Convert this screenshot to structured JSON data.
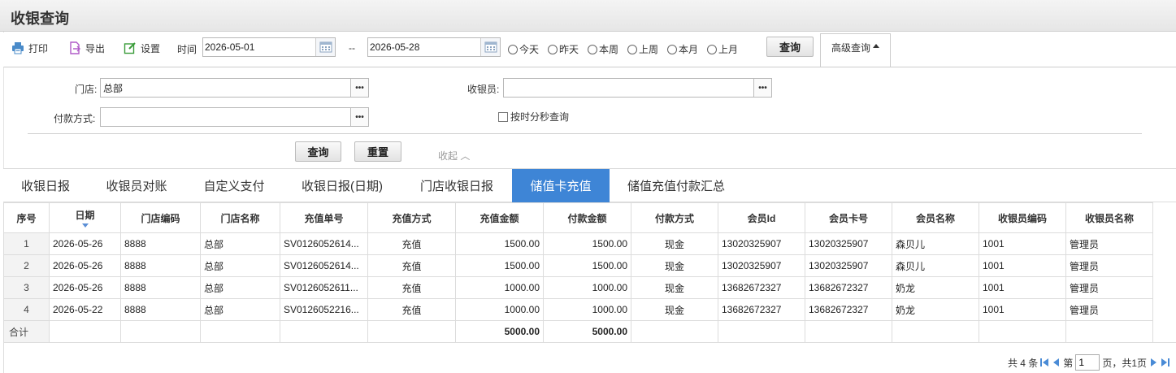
{
  "window": {
    "title": "收银查询"
  },
  "toolbar": {
    "print_label": "打印",
    "export_label": "导出",
    "settings_label": "设置",
    "time_label": "时间",
    "date_from": "2026-05-01",
    "date_sep": "--",
    "date_to": "2026-05-28",
    "quick_ranges": [
      "今天",
      "昨天",
      "本周",
      "上周",
      "本月",
      "上月"
    ],
    "query_label": "查询",
    "advanced_label": "高级查询"
  },
  "advanced": {
    "store_label": "门店:",
    "store_value": "总部",
    "cashier_label": "收银员:",
    "cashier_value": "",
    "payment_label": "付款方式:",
    "payment_value": "",
    "by_seconds_label": "按时分秒查询",
    "query_label": "查询",
    "reset_label": "重置",
    "collapse_label": "收起 ︿"
  },
  "tabs": [
    {
      "label": "收银日报",
      "active": false
    },
    {
      "label": "收银员对账",
      "active": false
    },
    {
      "label": "自定义支付",
      "active": false
    },
    {
      "label": "收银日报(日期)",
      "active": false
    },
    {
      "label": "门店收银日报",
      "active": false
    },
    {
      "label": "储值卡充值",
      "active": true
    },
    {
      "label": "储值充值付款汇总",
      "active": false
    }
  ],
  "table": {
    "columns": [
      "序号",
      "日期",
      "门店编码",
      "门店名称",
      "充值单号",
      "充值方式",
      "充值金额",
      "付款金额",
      "付款方式",
      "会员Id",
      "会员卡号",
      "会员名称",
      "收银员编码",
      "收银员名称"
    ],
    "rows": [
      [
        "1",
        "2026-05-26",
        "8888",
        "总部",
        "SV0126052614...",
        "充值",
        "1500.00",
        "1500.00",
        "现金",
        "13020325907",
        "13020325907",
        "森贝儿",
        "1001",
        "管理员"
      ],
      [
        "2",
        "2026-05-26",
        "8888",
        "总部",
        "SV0126052614...",
        "充值",
        "1500.00",
        "1500.00",
        "现金",
        "13020325907",
        "13020325907",
        "森贝儿",
        "1001",
        "管理员"
      ],
      [
        "3",
        "2026-05-26",
        "8888",
        "总部",
        "SV0126052611...",
        "充值",
        "1000.00",
        "1000.00",
        "现金",
        "13682672327",
        "13682672327",
        "奶龙",
        "1001",
        "管理员"
      ],
      [
        "4",
        "2026-05-22",
        "8888",
        "总部",
        "SV0126052216...",
        "充值",
        "1000.00",
        "1000.00",
        "现金",
        "13682672327",
        "13682672327",
        "奶龙",
        "1001",
        "管理员"
      ]
    ],
    "total": {
      "label": "合计",
      "charge_total": "5000.00",
      "pay_total": "5000.00"
    }
  },
  "pager": {
    "total_text": "共 4 条",
    "page_prefix": "第",
    "page_value": "1",
    "page_suffix": "页，共1页"
  },
  "colors": {
    "active_tab": "#3e85d6",
    "sort_arrow": "#5b8fd6"
  }
}
